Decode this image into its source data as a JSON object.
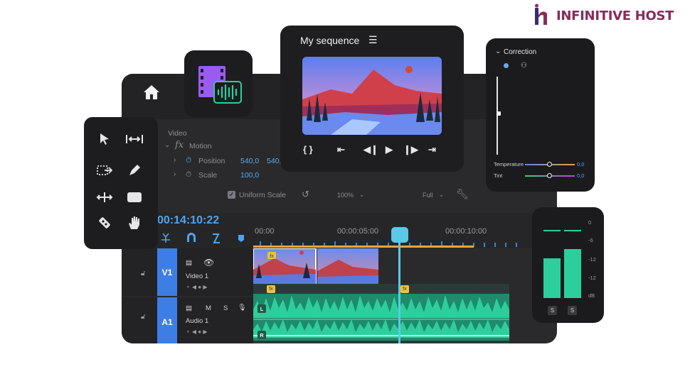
{
  "brand": {
    "name": "INFINITIVE HOST",
    "colors": {
      "primary": "#3b2a6e",
      "accent": "#8a2a5a"
    }
  },
  "sequence": {
    "title": "My sequence",
    "menu_icon": "hamburger-icon"
  },
  "effects": {
    "section": "Video",
    "motion_label": "Motion",
    "position_label": "Position",
    "position_x": "540,0",
    "position_y": "540,",
    "scale_label": "Scale",
    "scale_value": "100,0",
    "uniform_scale_label": "Uniform Scale",
    "zoom": "100%",
    "resolution": "Full"
  },
  "timeline": {
    "timecode": "00:14:10:22",
    "ruler": [
      "00:00",
      "00:00:05:00",
      "00:00:10:00"
    ],
    "tracks": [
      {
        "id": "V1",
        "name": "Video 1"
      },
      {
        "id": "A1",
        "name": "Audio 1",
        "m": "M",
        "s": "S"
      }
    ],
    "channels": [
      "L",
      "R"
    ],
    "fx_badge": "fx"
  },
  "correction": {
    "title": "Correction",
    "temperature_label": "Temperature",
    "temperature_value": "0,0",
    "tint_label": "Tint",
    "tint_value": "0,0"
  },
  "meter": {
    "scale": [
      "0",
      "-6",
      "-12",
      "-12",
      "dB"
    ],
    "solo": [
      "S",
      "S"
    ],
    "levels": [
      0.52,
      0.64
    ]
  },
  "colors": {
    "accent": "#4fa3f0",
    "track": "#3d7de6",
    "audio": "#26c493",
    "playhead": "#5cc8e8",
    "fx": "#e8c34a"
  }
}
